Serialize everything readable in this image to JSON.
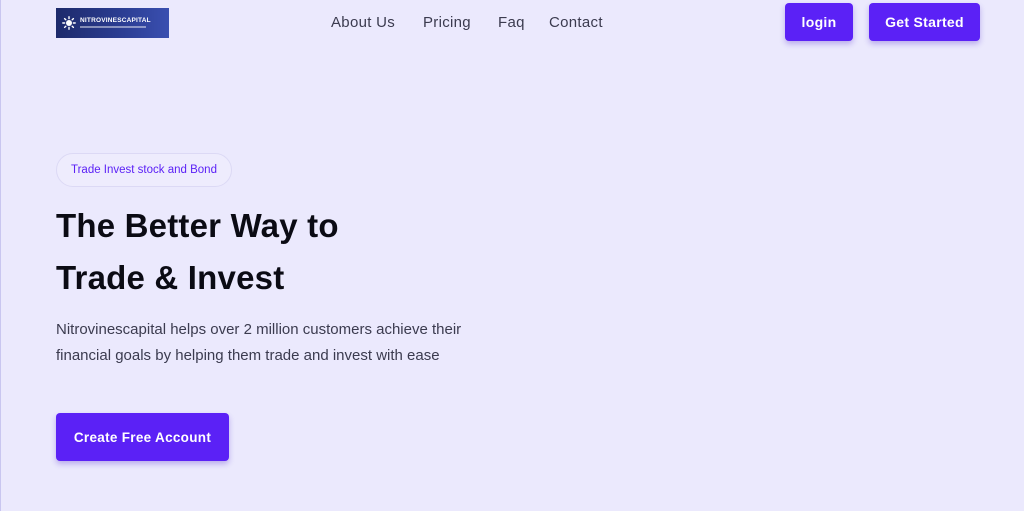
{
  "header": {
    "logo_text": "NITROVINESCAPITAL",
    "nav": {
      "about": "About Us",
      "pricing": "Pricing",
      "faq": "Faq",
      "contact": "Contact"
    },
    "login_label": "login",
    "get_started_label": "Get Started"
  },
  "hero": {
    "badge": "Trade Invest stock and Bond",
    "headline_line1": "The Better Way to",
    "headline_line2": "Trade & Invest",
    "description": "Nitrovinescapital helps over 2 million customers achieve their financial goals by helping them trade and invest with ease",
    "cta_label": "Create Free Account"
  },
  "colors": {
    "background": "#ebe9fd",
    "accent": "#5b21f6",
    "heading": "#0b0b14",
    "body_text": "#3b3b4f"
  },
  "icons": {
    "logo_mark": "gear-sun-icon"
  }
}
